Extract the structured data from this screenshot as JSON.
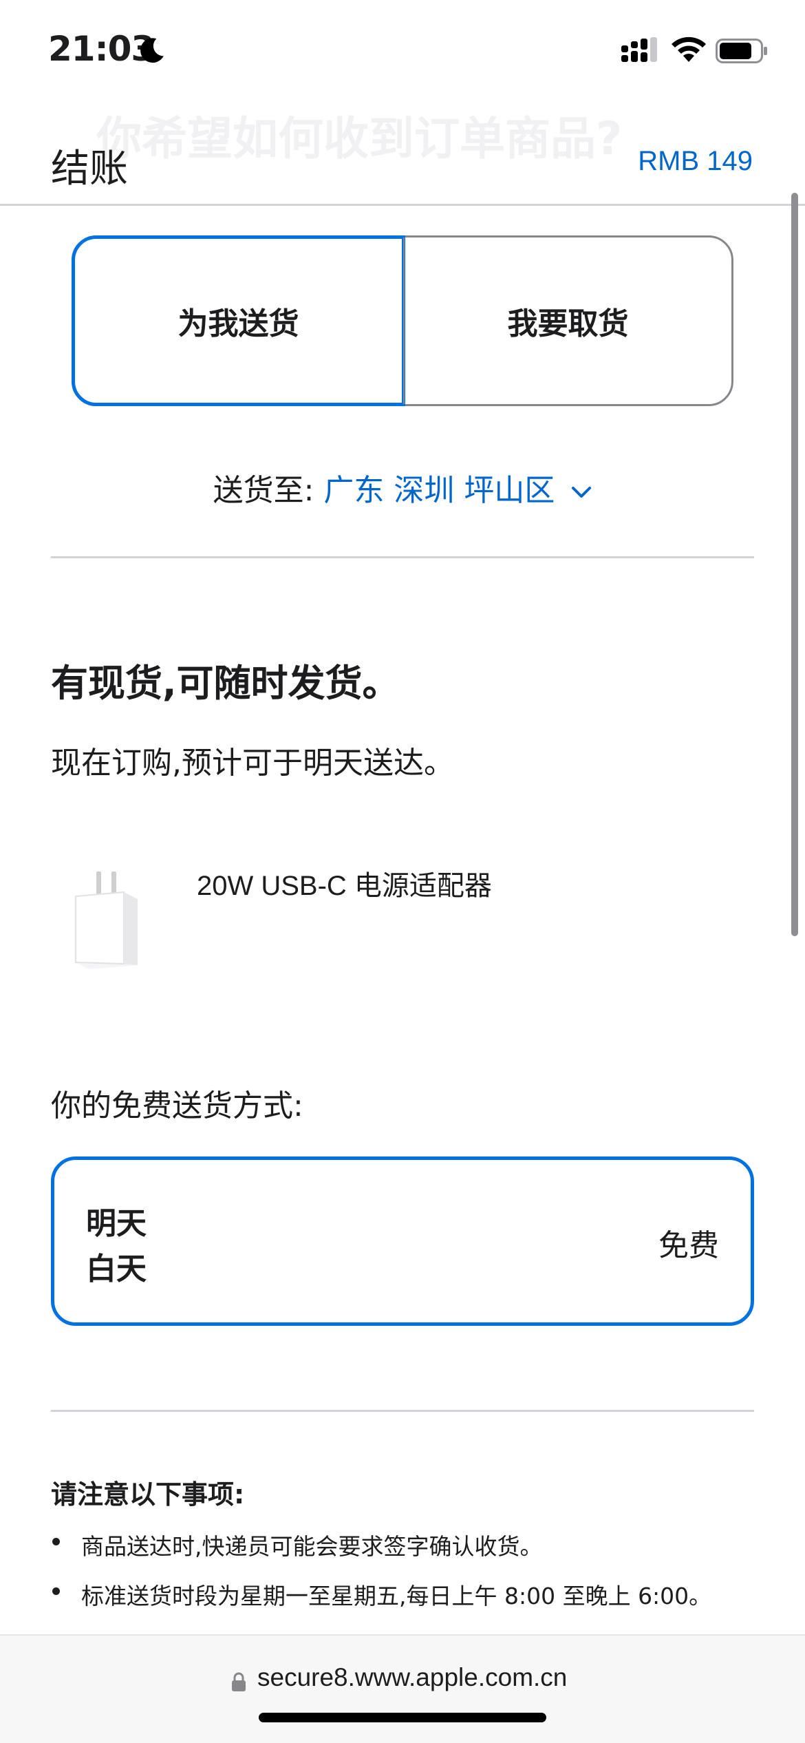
{
  "status_bar": {
    "time": "21:03",
    "icons": [
      "moon-icon",
      "cellular-signal-icon",
      "wifi-icon",
      "battery-icon"
    ]
  },
  "header": {
    "ghost_title": "你希望如何收到订单商品?",
    "title": "结账",
    "total": "RMB 149"
  },
  "delivery_toggle": {
    "options": [
      {
        "label": "为我送货",
        "selected": true
      },
      {
        "label": "我要取货",
        "selected": false
      }
    ]
  },
  "ship_to": {
    "prefix": "送货至:",
    "location": "广东 深圳 坪山区"
  },
  "availability": {
    "title": "有现货,可随时发货。",
    "subtitle": "现在订购,预计可于明天送达。"
  },
  "product": {
    "name": "20W USB-C 电源适配器",
    "image_icon": "power-adapter-image"
  },
  "shipping_method": {
    "label": "你的免费送货方式:",
    "day": "明天",
    "time": "白天",
    "price": "免费"
  },
  "notes": {
    "title": "请注意以下事项:",
    "items": [
      "商品送达时,快递员可能会要求签字确认收货。",
      "标准送货时段为星期一至星期五,每日上午 8:00 至晚上 6:00。"
    ]
  },
  "browser": {
    "url": "secure8.www.apple.com.cn"
  },
  "colors": {
    "accent": "#0071e3",
    "link": "#0066cc",
    "text": "#1d1d1f",
    "divider": "#d2d2d7"
  }
}
